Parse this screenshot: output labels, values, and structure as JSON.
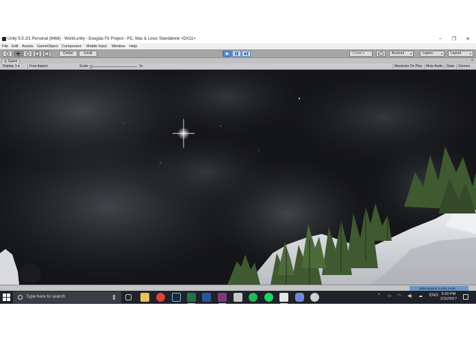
{
  "window": {
    "title": "Unity 5.5.1f1 Personal (64bit) - World.unity - Douglas Fir Project - PC, Mac & Linux Standalone <DX11>",
    "minimize": "–",
    "maximize": "❐",
    "close": "✕"
  },
  "menu": [
    "File",
    "Edit",
    "Assets",
    "GameObject",
    "Component",
    "Mobile Input",
    "Window",
    "Help"
  ],
  "toolbar": {
    "pivot_label": "Center",
    "space_label": "Local",
    "play_icon": "play-icon",
    "pause_icon": "pause-icon",
    "step_icon": "step-icon",
    "collab_label": "Collab ▾",
    "account_label": "Account",
    "layers_label": "Layers",
    "layout_label": "Layout"
  },
  "game_tab": {
    "label": "Game",
    "display": "Display 1",
    "aspect": "Free Aspect",
    "scale_label": "Scale",
    "scale_value": "1x",
    "scale_level": 0.0,
    "maximize_on_play": "Maximize On Play",
    "mute_audio": "Mute Audio",
    "stats": "Stats",
    "gizmos": "Gizmos"
  },
  "status": {
    "message": "Bake paused in play mode"
  },
  "taskbar": {
    "search_placeholder": "Type here to search",
    "apps": [
      "task-view-icon",
      "file-explorer-icon",
      "chrome-icon",
      "steam-icon",
      "excel-icon",
      "word-icon",
      "onenote-icon",
      "package-icon",
      "spotify-icon",
      "spotify-alt-icon",
      "unity-icon",
      "discord-icon",
      "settings-app-icon"
    ],
    "tray": {
      "chevron": "^",
      "language": "ENG"
    },
    "time": "5:20 PM",
    "date": "2/11/2017"
  },
  "colors": {
    "unity_toolbar": "#a5a5a5",
    "play_active": "#4a8fd6",
    "taskbar": "#1f2229",
    "sky": "#141518",
    "snow": "#e8eaec",
    "tree": "#3f5a30"
  }
}
